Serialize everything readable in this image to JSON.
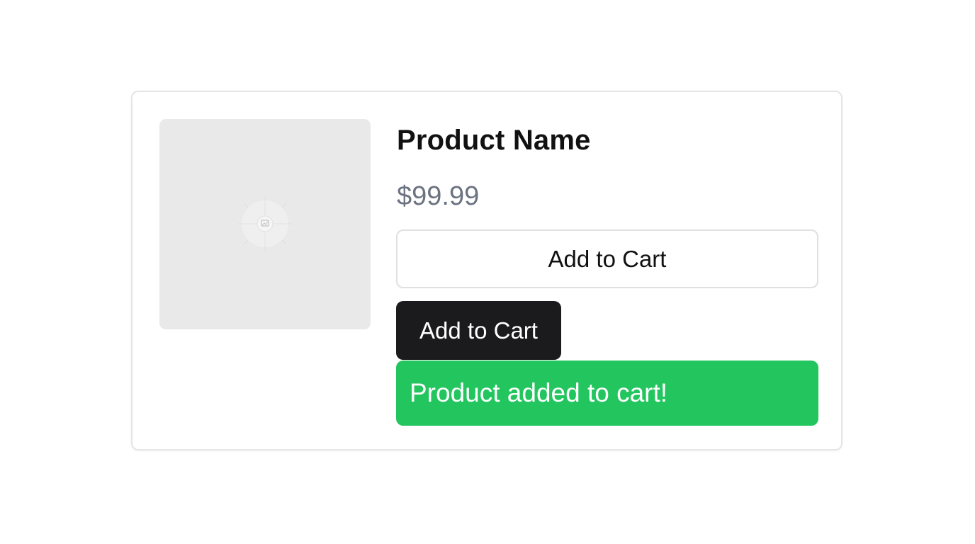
{
  "product": {
    "image_icon": "image-icon",
    "title": "Product Name",
    "price": "$99.99"
  },
  "actions": {
    "add_to_cart_outline_label": "Add to Cart",
    "add_to_cart_dark_label": "Add to Cart"
  },
  "notification": {
    "message": "Product added to cart!"
  },
  "colors": {
    "success": "#22c55e",
    "dark_button": "#1b1b1d",
    "price_text": "#6b7280",
    "placeholder_bg": "#e9e9e9"
  }
}
